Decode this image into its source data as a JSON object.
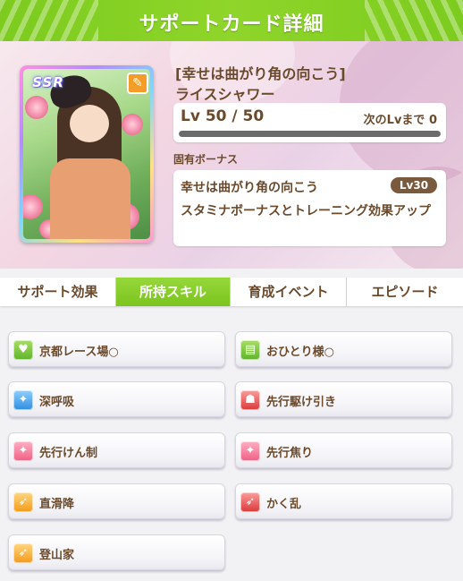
{
  "header": {
    "title": "サポートカード詳細"
  },
  "card": {
    "rarity": "SSR",
    "type_icon": "power-flex-icon",
    "type_color": "#f39c28",
    "title": "[幸せは曲がり角の向こう]",
    "name": "ライスシャワー",
    "level_text": "Lv 50 / 50",
    "next_level_text": "次のLvまで 0",
    "level_progress": 1.0
  },
  "unique_bonus": {
    "heading": "固有ボーナス",
    "name": "幸せは曲がり角の向こう",
    "level": "Lv30",
    "description": "スタミナボーナスとトレーニング効果アップ"
  },
  "tabs": [
    {
      "label": "サポート効果",
      "active": false
    },
    {
      "label": "所持スキル",
      "active": true
    },
    {
      "label": "育成イベント",
      "active": false
    },
    {
      "label": "エピソード",
      "active": false
    }
  ],
  "skills": [
    {
      "name": "京都レース場○",
      "icon": "heart-icon",
      "color": "green",
      "glyph": "♥"
    },
    {
      "name": "おひとり様○",
      "icon": "lone-runner-icon",
      "color": "green",
      "glyph": "▤"
    },
    {
      "name": "深呼吸",
      "icon": "sparkle-icon",
      "color": "blue",
      "glyph": "✦"
    },
    {
      "name": "先行駆け引き",
      "icon": "devil-icon",
      "color": "red",
      "glyph": "☗"
    },
    {
      "name": "先行けん制",
      "icon": "sparkle-icon",
      "color": "pink",
      "glyph": "✦"
    },
    {
      "name": "先行焦り",
      "icon": "sparkle-icon",
      "color": "pink",
      "glyph": "✦"
    },
    {
      "name": "直滑降",
      "icon": "runner-icon",
      "color": "orange",
      "glyph": "➶"
    },
    {
      "name": "かく乱",
      "icon": "runner-icon",
      "color": "red",
      "glyph": "➶"
    },
    {
      "name": "登山家",
      "icon": "runner-icon",
      "color": "orange",
      "glyph": "➶"
    }
  ]
}
